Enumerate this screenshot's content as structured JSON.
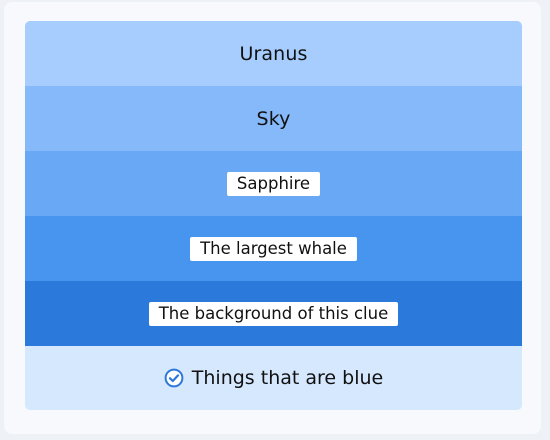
{
  "clues": [
    {
      "text": "Uranus",
      "style": "plain"
    },
    {
      "text": "Sky",
      "style": "plain"
    },
    {
      "text": "Sapphire",
      "style": "chip"
    },
    {
      "text": "The largest whale",
      "style": "chip"
    },
    {
      "text": "The background of this clue",
      "style": "chip"
    }
  ],
  "answer": {
    "label": "Things that are blue",
    "icon": "check-circle-icon",
    "status": "solved"
  },
  "colors": {
    "row_1": "#a6cdfd",
    "row_2": "#86b9f9",
    "row_3": "#68a8f4",
    "row_4": "#4795ef",
    "row_5": "#2c79dc",
    "answer_background": "#d5e8fd",
    "check_icon": "#2c79dc"
  }
}
